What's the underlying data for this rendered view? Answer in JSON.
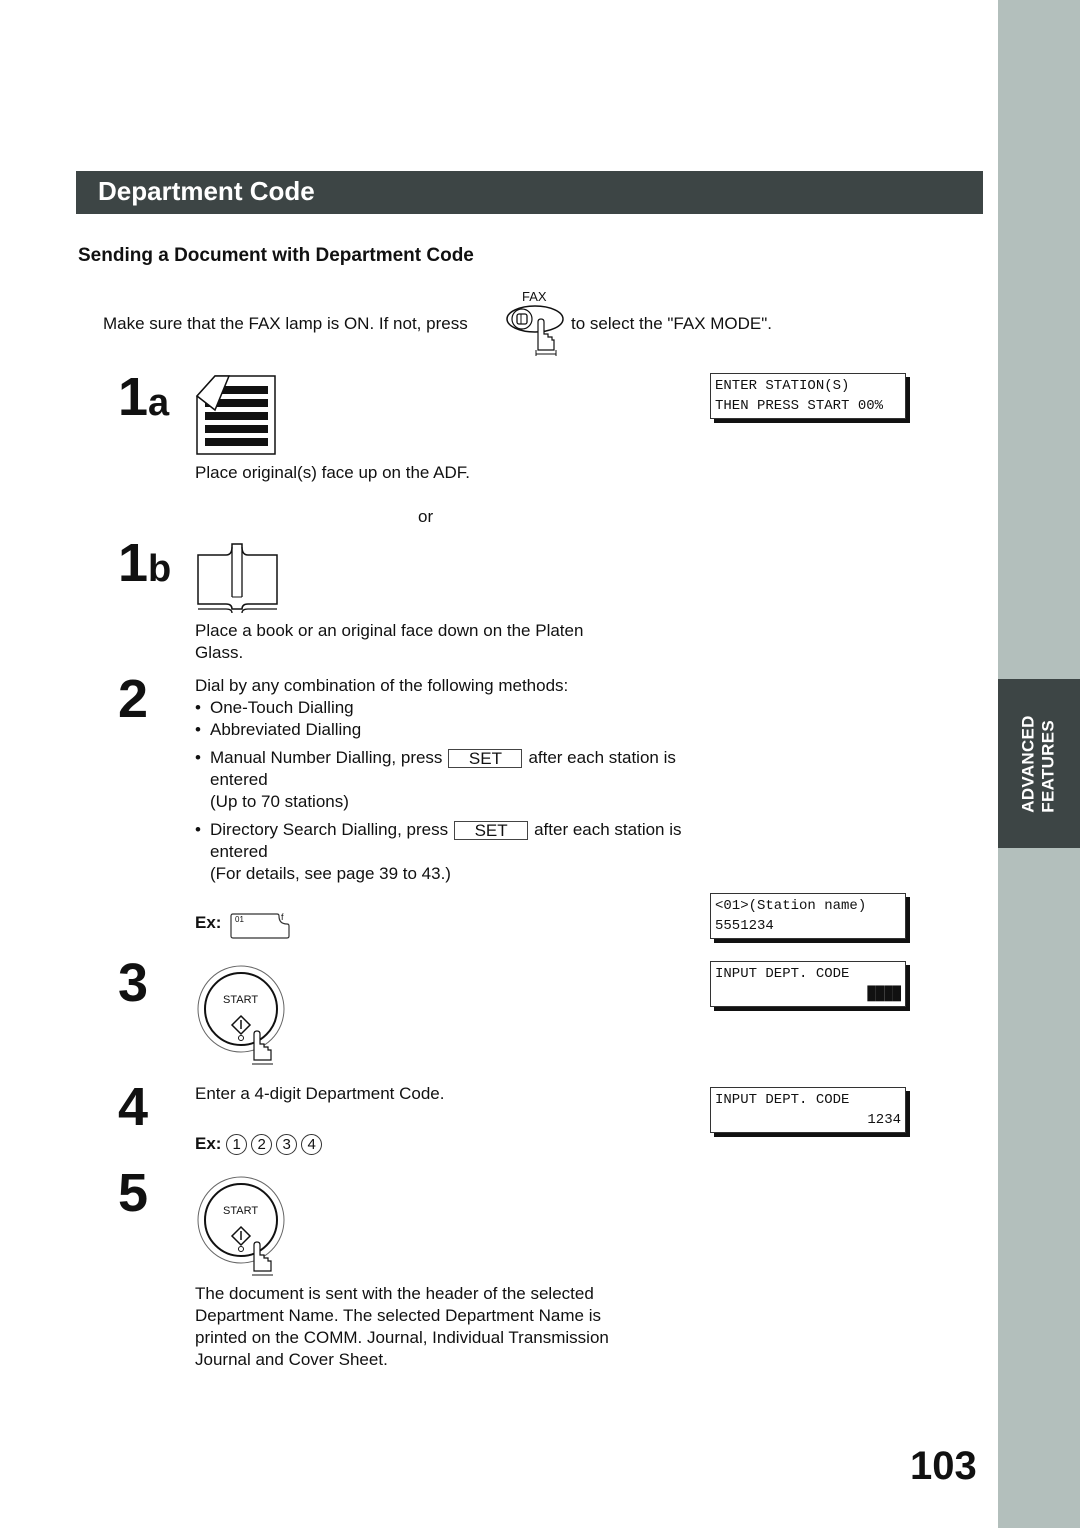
{
  "sidebar": {
    "tab_line1": "ADVANCED",
    "tab_line2": "FEATURES",
    "colors": {
      "strip": "#b3bfbc",
      "tab": "#3d4545"
    }
  },
  "header": {
    "title": "Department Code",
    "subtitle": "Sending a Document with Department Code",
    "banner_color": "#3d4545"
  },
  "intro": {
    "text_before": "Make sure that the FAX lamp is ON.  If not, press",
    "fax_key_label": "FAX",
    "text_after": "to select the \"FAX MODE\"."
  },
  "steps": {
    "s1a": {
      "num": "1",
      "letter": "a",
      "icon": "adf-document-icon",
      "text": "Place original(s) face up on the ADF.",
      "lcd": [
        "ENTER STATION(S)",
        "THEN PRESS START 00%"
      ]
    },
    "or_text": "or",
    "s1b": {
      "num": "1",
      "letter": "b",
      "icon": "book-icon",
      "text_line1": "Place a book or an original face down on the Platen",
      "text_line2": "Glass."
    },
    "s2": {
      "num": "2",
      "intro": "Dial by any combination of the following methods:",
      "methods": [
        "One-Touch Dialling",
        "Abbreviated Dialling"
      ],
      "manual_before": "Manual Number Dialling, press",
      "manual_after": "after each station is",
      "manual_line2": "entered",
      "manual_line3": "(Up to 70 stations)",
      "directory_before": "Directory Search Dialling, press",
      "directory_after": "after each station is",
      "directory_line2": "entered",
      "directory_line3": "(For details, see page 39 to 43.)",
      "set_key": "SET",
      "ex_label": "Ex:",
      "ex_key_number": "01",
      "ex_key_letter": "f",
      "lcd": [
        "<01>(Station name)",
        "5551234"
      ]
    },
    "s3": {
      "num": "3",
      "start_label": "START",
      "lcd": [
        "INPUT DEPT. CODE",
        "████"
      ]
    },
    "s4": {
      "num": "4",
      "text": "Enter a 4-digit Department Code.",
      "ex_label": "Ex:",
      "digits": [
        "1",
        "2",
        "3",
        "4"
      ],
      "lcd": [
        "INPUT DEPT. CODE",
        "1234"
      ]
    },
    "s5": {
      "num": "5",
      "start_label": "START",
      "text_lines": [
        "The document is sent with the header of the selected",
        "Department Name.  The selected Department Name is",
        "printed on the COMM. Journal, Individual Transmission",
        "Journal and Cover Sheet."
      ]
    }
  },
  "footer": {
    "page_number": "103"
  }
}
